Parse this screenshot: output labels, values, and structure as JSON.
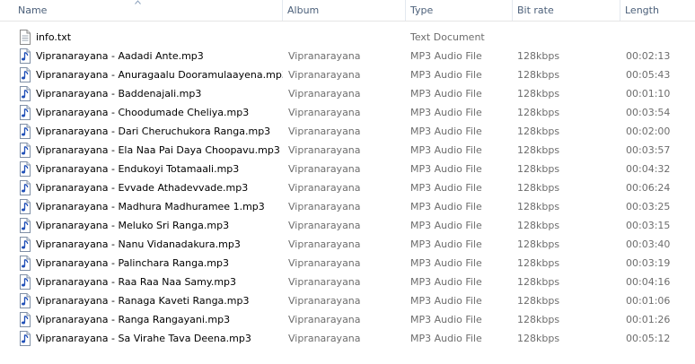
{
  "columns": {
    "name": "Name",
    "album": "Album",
    "type": "Type",
    "bitrate": "Bit rate",
    "length": "Length"
  },
  "files": [
    {
      "name": "info.txt",
      "album": "",
      "type": "Text Document",
      "bitrate": "",
      "length": "",
      "icon": "text-file-icon"
    },
    {
      "name": "Vipranarayana - Aadadi Ante.mp3",
      "album": "Vipranarayana",
      "type": "MP3 Audio File",
      "bitrate": "128kbps",
      "length": "00:02:13",
      "icon": "audio-file-icon"
    },
    {
      "name": "Vipranarayana - Anuragaalu Dooramulaayena.mp3",
      "album": "Vipranarayana",
      "type": "MP3 Audio File",
      "bitrate": "128kbps",
      "length": "00:05:43",
      "icon": "audio-file-icon"
    },
    {
      "name": "Vipranarayana - Baddenajali.mp3",
      "album": "Vipranarayana",
      "type": "MP3 Audio File",
      "bitrate": "128kbps",
      "length": "00:01:10",
      "icon": "audio-file-icon"
    },
    {
      "name": "Vipranarayana - Choodumade Cheliya.mp3",
      "album": "Vipranarayana",
      "type": "MP3 Audio File",
      "bitrate": "128kbps",
      "length": "00:03:54",
      "icon": "audio-file-icon"
    },
    {
      "name": "Vipranarayana - Dari Cheruchukora Ranga.mp3",
      "album": "Vipranarayana",
      "type": "MP3 Audio File",
      "bitrate": "128kbps",
      "length": "00:02:00",
      "icon": "audio-file-icon"
    },
    {
      "name": "Vipranarayana - Ela Naa Pai Daya Choopavu.mp3",
      "album": "Vipranarayana",
      "type": "MP3 Audio File",
      "bitrate": "128kbps",
      "length": "00:03:57",
      "icon": "audio-file-icon"
    },
    {
      "name": "Vipranarayana - Endukoyi Totamaali.mp3",
      "album": "Vipranarayana",
      "type": "MP3 Audio File",
      "bitrate": "128kbps",
      "length": "00:04:32",
      "icon": "audio-file-icon"
    },
    {
      "name": "Vipranarayana - Evvade Athadevvade.mp3",
      "album": "Vipranarayana",
      "type": "MP3 Audio File",
      "bitrate": "128kbps",
      "length": "00:06:24",
      "icon": "audio-file-icon"
    },
    {
      "name": "Vipranarayana - Madhura Madhuramee 1.mp3",
      "album": "Vipranarayana",
      "type": "MP3 Audio File",
      "bitrate": "128kbps",
      "length": "00:03:25",
      "icon": "audio-file-icon"
    },
    {
      "name": "Vipranarayana - Meluko Sri Ranga.mp3",
      "album": "Vipranarayana",
      "type": "MP3 Audio File",
      "bitrate": "128kbps",
      "length": "00:03:15",
      "icon": "audio-file-icon"
    },
    {
      "name": "Vipranarayana - Nanu Vidanadakura.mp3",
      "album": "Vipranarayana",
      "type": "MP3 Audio File",
      "bitrate": "128kbps",
      "length": "00:03:40",
      "icon": "audio-file-icon"
    },
    {
      "name": "Vipranarayana - Palinchara Ranga.mp3",
      "album": "Vipranarayana",
      "type": "MP3 Audio File",
      "bitrate": "128kbps",
      "length": "00:03:19",
      "icon": "audio-file-icon"
    },
    {
      "name": "Vipranarayana - Raa Raa Naa Samy.mp3",
      "album": "Vipranarayana",
      "type": "MP3 Audio File",
      "bitrate": "128kbps",
      "length": "00:04:16",
      "icon": "audio-file-icon"
    },
    {
      "name": "Vipranarayana - Ranaga Kaveti Ranga.mp3",
      "album": "Vipranarayana",
      "type": "MP3 Audio File",
      "bitrate": "128kbps",
      "length": "00:01:06",
      "icon": "audio-file-icon"
    },
    {
      "name": "Vipranarayana - Ranga Rangayani.mp3",
      "album": "Vipranarayana",
      "type": "MP3 Audio File",
      "bitrate": "128kbps",
      "length": "00:01:26",
      "icon": "audio-file-icon"
    },
    {
      "name": "Vipranarayana - Sa Virahe Tava Deena.mp3",
      "album": "Vipranarayana",
      "type": "MP3 Audio File",
      "bitrate": "128kbps",
      "length": "00:05:12",
      "icon": "audio-file-icon"
    }
  ]
}
